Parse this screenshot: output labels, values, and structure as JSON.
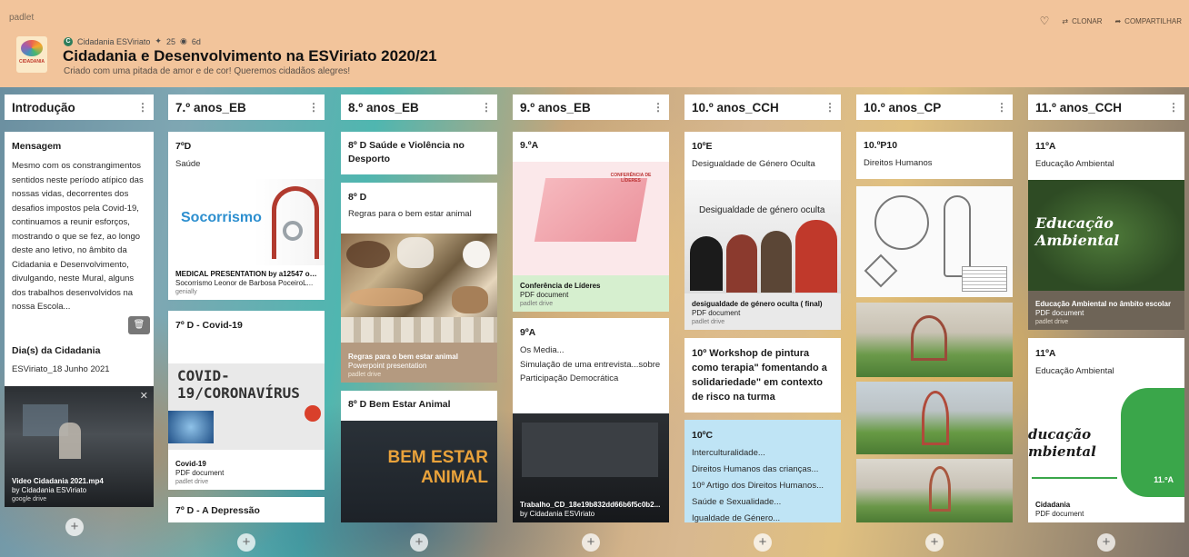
{
  "header": {
    "brand": "padlet",
    "author": "Cidadania ESViriato",
    "author_initial": "C",
    "likes": "25",
    "age": "6d",
    "title": "Cidadania e Desenvolvimento na ESViriato 2020/21",
    "subtitle": "Criado com uma pitada de amor e de cor! Queremos cidadãos alegres!",
    "logo_text": "CIDADANIA",
    "clone_label": "CLONAR",
    "share_label": "COMPARTILHAR"
  },
  "columns": [
    {
      "title": "Introdução",
      "cards": [
        {
          "title": "Mensagem",
          "body": "Mesmo com os constrangimentos sentidos neste período atípico das nossas vidas, decorrentes dos desafios impostos pela Covid-19, continuamos a reunir esforços, mostrando o que se fez, ao longo deste ano letivo, no âmbito da Cidadania e Desenvolvimento, divulgando, neste Mural, alguns dos trabalhos desenvolvidos na nossa Escola..."
        },
        {
          "title": "Dia(s) da Cidadania",
          "body": "ESViriato_18 Junho 2021",
          "att_name": "Video Cidadania 2021.mp4",
          "att_type": "by Cidadania ESViriato",
          "att_src": "google drive"
        }
      ]
    },
    {
      "title": "7.º anos_EB",
      "cards": [
        {
          "title": "7ºD",
          "body": "Saúde",
          "image_text": "Socorrismo",
          "att_name": "MEDICAL PRESENTATION by a12547 on...",
          "att_type": "Socorrismo Leonor de Barbosa PoceiroL...",
          "att_src": "genially"
        },
        {
          "title": "7º D - Covid-19",
          "image_text": "COVID-19/CORONAVÍRUS",
          "att_name": "Covid-19",
          "att_type": "PDF document",
          "att_src": "padlet drive"
        },
        {
          "title": "7º D - A Depressão"
        }
      ]
    },
    {
      "title": "8.º anos_EB",
      "cards": [
        {
          "title": "8º D Saúde e Violência no Desporto"
        },
        {
          "title": "8º D",
          "body": "Regras para o bem estar animal",
          "att_name": "Regras para o bem estar animal",
          "att_type": "Powerpoint presentation",
          "att_src": "padlet drive"
        },
        {
          "title": "8º D Bem Estar Animal",
          "image_text": "BEM ESTAR ANIMAL"
        }
      ]
    },
    {
      "title": "9.º anos_EB",
      "cards": [
        {
          "title": "9.ºA",
          "image_text": "CONFERÊNCIA DE LÍDERES",
          "att_name": "Conferência de Líderes",
          "att_type": "PDF document",
          "att_src": "padlet drive"
        },
        {
          "title": "9ºA",
          "body_lines": [
            "Os Media...",
            "Simulação de uma entrevista...sobre Participação Democrática"
          ],
          "att_name": "Trabalho_CD_18e19b832dd66b6f5c0b2...",
          "att_type": "by Cidadania ESViriato"
        }
      ]
    },
    {
      "title": "10.º anos_CCH",
      "cards": [
        {
          "title": "10ºE",
          "body": "Desigualdade de Género Oculta",
          "image_text": "Desigualdade de género oculta",
          "att_name": "desigualdade de género oculta ( final)",
          "att_type": "PDF document",
          "att_src": "padlet drive"
        },
        {
          "title": "10º Workshop de pintura como terapia\" fomentando a solidariedade\" em contexto de risco na turma"
        },
        {
          "title": "10ºC",
          "body_lines": [
            "Interculturalidade...",
            "Direitos Humanos das crianças...",
            "10º Artigo dos Direitos Humanos...",
            "Saúde e Sexualidade...",
            "Igualdade de Género..."
          ]
        }
      ]
    },
    {
      "title": "10.º anos_CP",
      "cards": [
        {
          "title": "10.ºP10",
          "body": "Direitos Humanos"
        }
      ]
    },
    {
      "title": "11.º anos_CCH",
      "cards": [
        {
          "title": "11ºA",
          "body": "Educação Ambiental",
          "image_text": "Educação Ambiental",
          "att_name": "Educação Ambiental no âmbito escolar",
          "att_type": "PDF document",
          "att_src": "padlet drive"
        },
        {
          "title": "11ºA",
          "body": "Educação Ambiental",
          "image_text": "ducação mbiental",
          "image_badge": "11.ºA",
          "att_name": "Cidadania",
          "att_type": "PDF document"
        }
      ]
    }
  ],
  "colors": {
    "header_bg": "#f2c49b",
    "card_bg": "#ffffff",
    "attachment_green": "#d6efcf",
    "attachment_gray": "#e9e9e9",
    "tan": "#b49a80",
    "lightblue": "#bfe4f5"
  }
}
